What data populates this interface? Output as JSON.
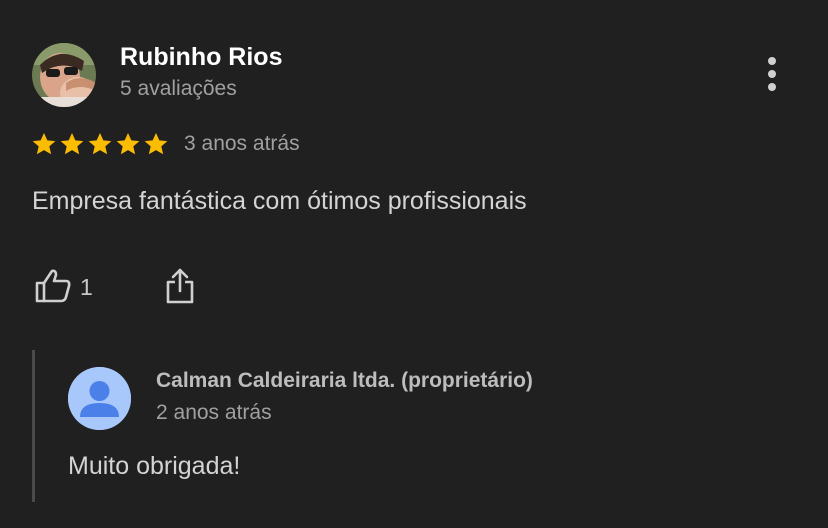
{
  "review": {
    "reviewer_name": "Rubinho Rios",
    "reviewer_review_count": "5 avaliações",
    "rating": 5,
    "rating_max": 5,
    "date": "3 anos atrás",
    "text": "Empresa fantástica com ótimos profissionais",
    "like_count": "1"
  },
  "reply": {
    "owner_name": "Calman Caldeiraria ltda. (proprietário)",
    "date": "2 anos atrás",
    "text": "Muito obrigada!"
  },
  "icons": {
    "more": "more-vert-icon",
    "like": "thumb-up-icon",
    "share": "share-icon",
    "star": "star-icon"
  },
  "colors": {
    "background": "#202020",
    "star": "#fbbc04",
    "owner_avatar_bg": "#a8c7fa",
    "owner_avatar_fg": "#4a80e8"
  }
}
